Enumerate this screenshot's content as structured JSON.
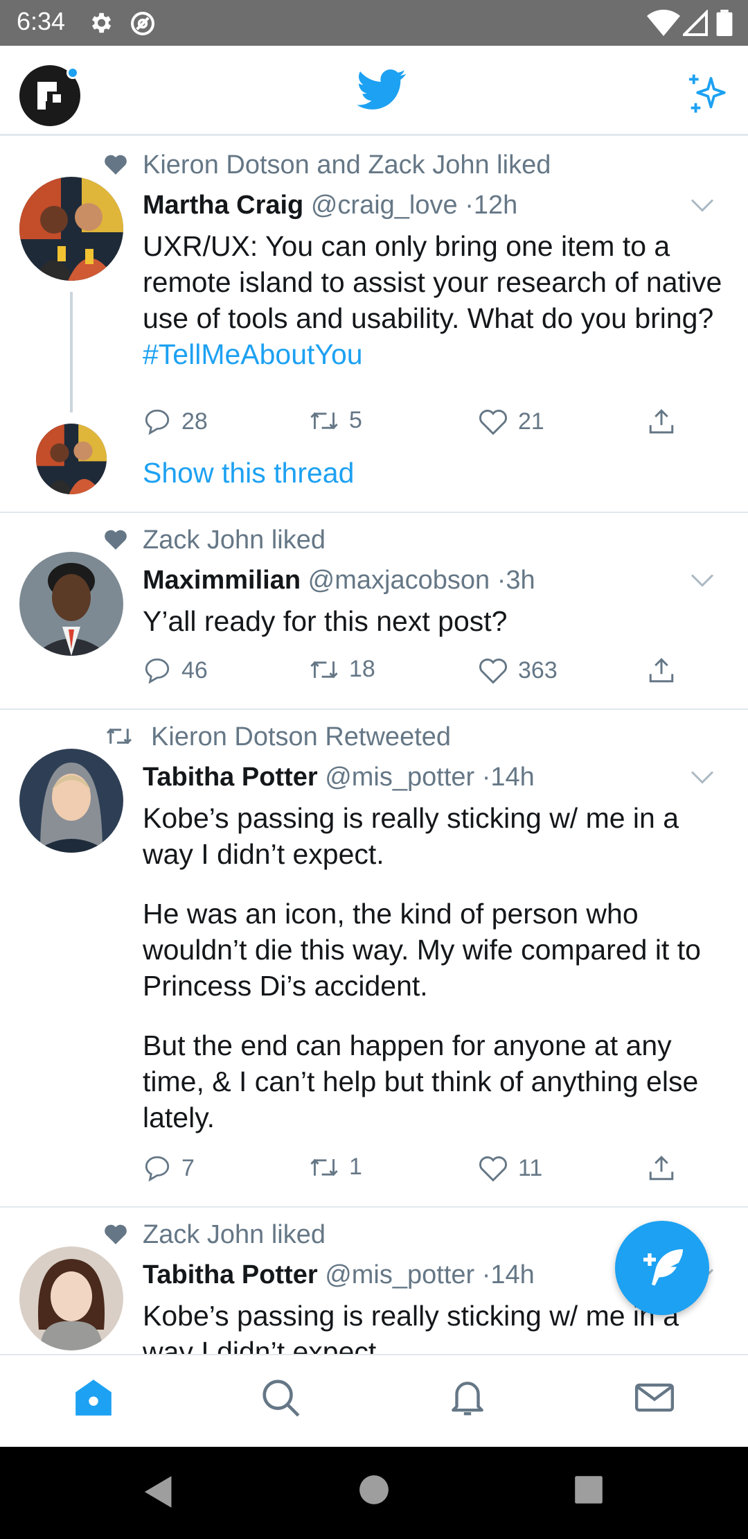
{
  "status_bar": {
    "time": "6:34",
    "icons": [
      "settings-gear-icon",
      "at-sign-icon",
      "wifi-icon",
      "signal-icon",
      "battery-icon"
    ]
  },
  "header": {
    "logo": "twitter-bird-icon",
    "right_icon": "sparkle-icon",
    "accent_color": "#1da1f2"
  },
  "tweets": [
    {
      "context": "Kieron Dotson and Zack John liked",
      "context_icon": "heart-icon",
      "name": "Martha Craig",
      "handle": "@craig_love",
      "time": "·12h",
      "text_before_tag": "UXR/UX: You can only bring one item to a remote island to assist your research of native use of tools and usability. What do you bring? ",
      "hashtag": "#TellMeAboutYou",
      "replies": "28",
      "retweets": "5",
      "likes": "21",
      "show_thread": "Show this thread"
    },
    {
      "context": "Zack John liked",
      "context_icon": "heart-icon",
      "name": "Maximmilian",
      "handle": "@maxjacobson",
      "time": "·3h",
      "text": "Y’all ready for this next post?",
      "replies": "46",
      "retweets": "18",
      "likes": "363"
    },
    {
      "context": "Kieron Dotson Retweeted",
      "context_icon": "retweet-icon",
      "name": "Tabitha Potter",
      "handle": "@mis_potter",
      "time": "·14h",
      "paragraphs": [
        "Kobe’s passing is really sticking w/ me in a way I didn’t expect.",
        "He was an icon, the kind of person who wouldn’t die this way. My wife compared it to Princess Di’s accident.",
        "But the end can happen for anyone at any time, & I can’t help but think of anything else lately."
      ],
      "replies": "7",
      "retweets": "1",
      "likes": "11"
    },
    {
      "context": "Zack John liked",
      "context_icon": "heart-icon",
      "name": "Tabitha Potter",
      "handle": "@mis_potter",
      "time": "·14h",
      "text": "Kobe’s passing is really sticking w/ me in a way I didn’t expect."
    }
  ],
  "fab": {
    "icon": "compose-tweet-icon"
  },
  "bottom_nav": [
    "home-icon",
    "search-icon",
    "notifications-bell-icon",
    "messages-mail-icon"
  ],
  "system_nav": [
    "back-icon",
    "home-circle-icon",
    "recents-square-icon"
  ]
}
